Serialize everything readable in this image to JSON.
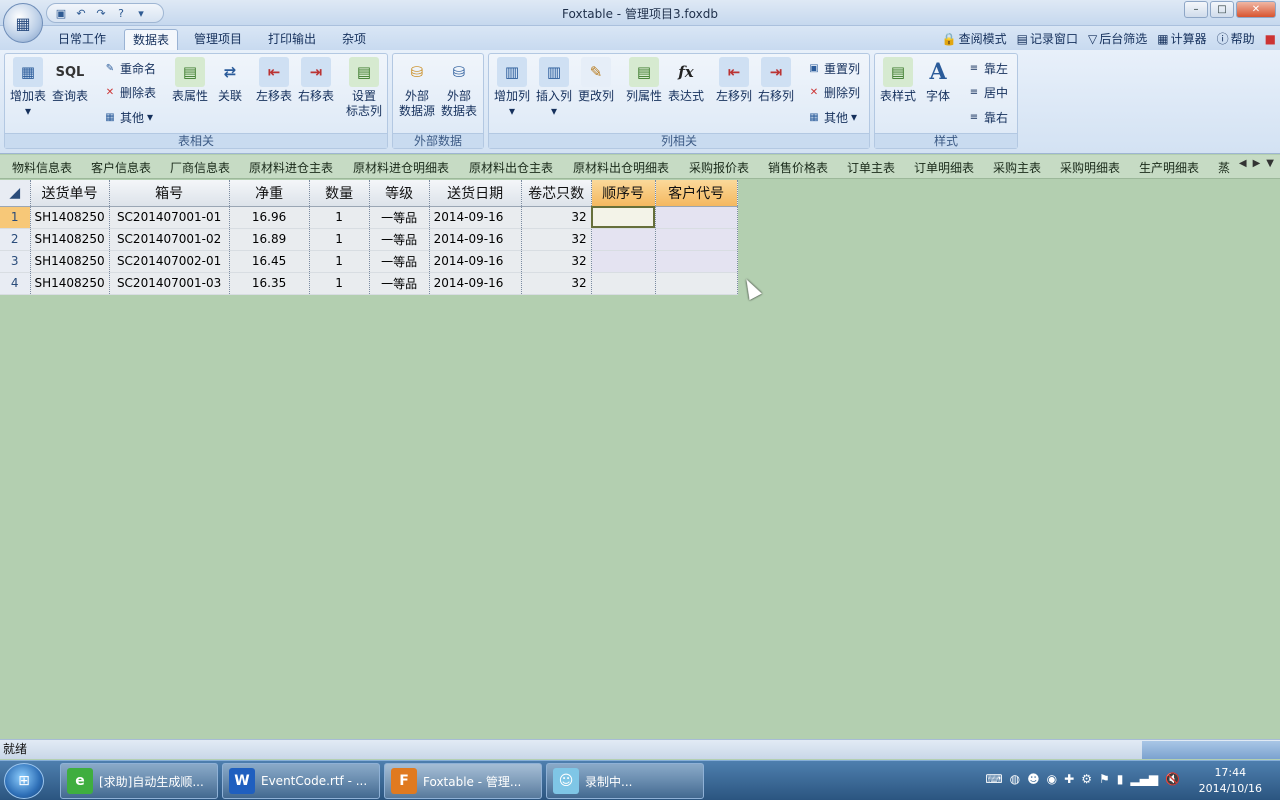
{
  "window": {
    "title": "Foxtable - 管理项目3.foxdb"
  },
  "menu_tabs": [
    "日常工作",
    "数据表",
    "管理项目",
    "打印输出",
    "杂项"
  ],
  "right_links": [
    "查阅模式",
    "记录窗口",
    "后台筛选",
    "计算器",
    "帮助"
  ],
  "ribbon": {
    "group_table": {
      "label": "表相关",
      "add": "增加表",
      "query": "查询表",
      "rename": "重命名",
      "delete": "删除表",
      "other": "其他",
      "props": "表属性",
      "relate": "关联",
      "left": "左移表",
      "right": "右移表",
      "setflag1": "设置",
      "setflag2": "标志列"
    },
    "group_external": {
      "label": "外部数据",
      "src1": "外部",
      "src2": "数据源",
      "tbl1": "外部",
      "tbl2": "数据表"
    },
    "group_column": {
      "label": "列相关",
      "add": "增加列",
      "insert": "插入列",
      "change": "更改列",
      "props": "列属性",
      "expr": "表达式",
      "left": "左移列",
      "right": "右移列",
      "reset": "重置列",
      "delete": "删除列",
      "other": "其他"
    },
    "group_style": {
      "label": "样式",
      "tstyle": "表样式",
      "font": "字体",
      "alignleft": "靠左",
      "center": "居中",
      "alignright": "靠右"
    }
  },
  "sheet_tabs": [
    "物料信息表",
    "客户信息表",
    "厂商信息表",
    "原材料进仓主表",
    "原材料进仓明细表",
    "原材料出仓主表",
    "原材料出仓明细表",
    "采购报价表",
    "销售价格表",
    "订单主表",
    "订单明细表",
    "采购主表",
    "采购明细表",
    "生产明细表",
    "蒸"
  ],
  "table": {
    "headers": [
      "送货单号",
      "箱号",
      "净重",
      "数量",
      "等级",
      "送货日期",
      "卷芯只数",
      "顺序号",
      "客户代号"
    ],
    "rows": [
      {
        "n": "1",
        "c": [
          "SH1408250",
          "SC201407001-01",
          "16.96",
          "1",
          "一等品",
          "2014-09-16",
          "32",
          "",
          ""
        ]
      },
      {
        "n": "2",
        "c": [
          "SH1408250",
          "SC201407001-02",
          "16.89",
          "1",
          "一等品",
          "2014-09-16",
          "32",
          "",
          ""
        ]
      },
      {
        "n": "3",
        "c": [
          "SH1408250",
          "SC201407002-01",
          "16.45",
          "1",
          "一等品",
          "2014-09-16",
          "32",
          "",
          ""
        ]
      },
      {
        "n": "4",
        "c": [
          "SH1408250",
          "SC201407001-03",
          "16.35",
          "1",
          "一等品",
          "2014-09-16",
          "32",
          "",
          ""
        ]
      }
    ]
  },
  "status": {
    "text": "就绪"
  },
  "taskbar": {
    "items": [
      "[求助]自动生成顺...",
      "EventCode.rtf - ...",
      "Foxtable - 管理...",
      "录制中..."
    ],
    "time": "17:44",
    "date": "2014/10/16"
  }
}
